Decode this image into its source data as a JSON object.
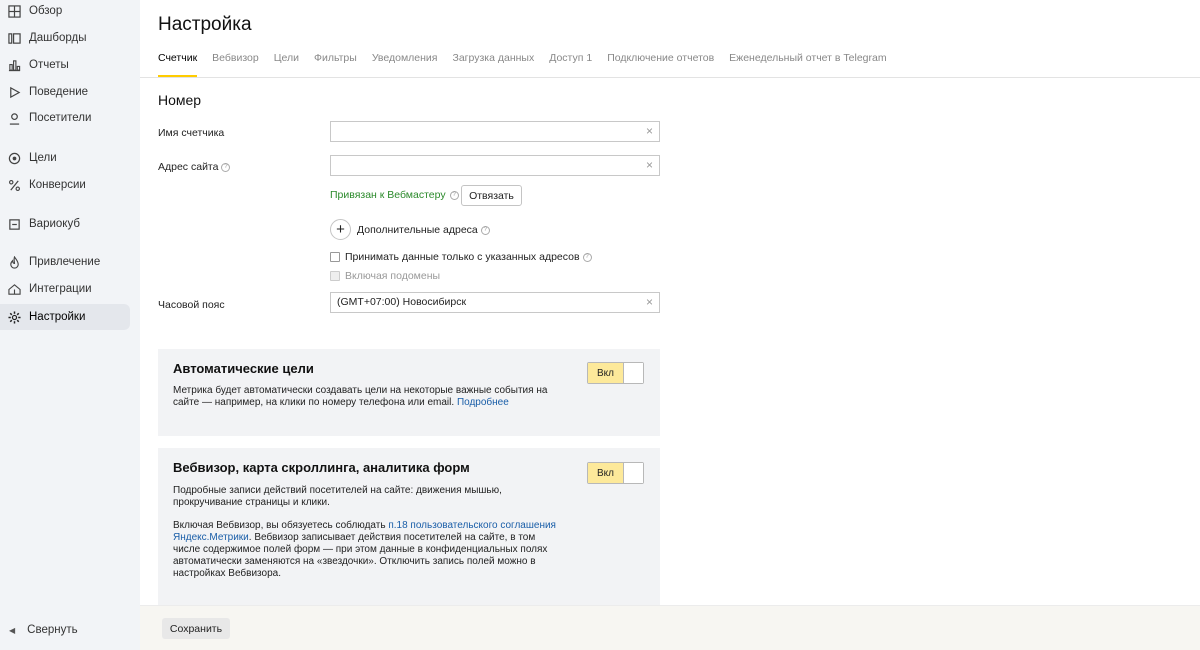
{
  "sidebar": {
    "items": [
      {
        "label": "Обзор",
        "icon": "grid-icon"
      },
      {
        "label": "Дашборды",
        "icon": "dashboards-icon"
      },
      {
        "label": "Отчеты",
        "icon": "bar-chart-icon"
      },
      {
        "label": "Поведение",
        "icon": "play-icon"
      },
      {
        "label": "Посетители",
        "icon": "user-icon"
      },
      {
        "label": "Цели",
        "icon": "target-icon"
      },
      {
        "label": "Конверсии",
        "icon": "percent-icon"
      },
      {
        "label": "Вариокуб",
        "icon": "cube-icon"
      },
      {
        "label": "Привлечение",
        "icon": "flame-icon"
      },
      {
        "label": "Интеграции",
        "icon": "integrations-icon"
      },
      {
        "label": "Настройки",
        "icon": "gear-icon",
        "active": true
      }
    ],
    "collapse_label": "Свернуть"
  },
  "header": {
    "title": "Настройка",
    "tabs": [
      {
        "label": "Счетчик",
        "active": true
      },
      {
        "label": "Вебвизор"
      },
      {
        "label": "Цели"
      },
      {
        "label": "Фильтры"
      },
      {
        "label": "Уведомления"
      },
      {
        "label": "Загрузка данных"
      },
      {
        "label": "Доступ 1"
      },
      {
        "label": "Подключение отчетов"
      },
      {
        "label": "Еженедельный отчет в Telegram"
      }
    ]
  },
  "form": {
    "section_title": "Номер",
    "counter_name_label": "Имя счетчика",
    "counter_name_value": "",
    "site_address_label": "Адрес сайта",
    "site_address_value": "",
    "webmaster_status": "Привязан к Вебмастеру",
    "unlink_label": "Отвязать",
    "additional_addresses_label": "Дополнительные адреса",
    "accept_only_label": "Принимать данные только с указанных адресов",
    "include_subdomains_label": "Включая подомены",
    "timezone_label": "Часовой пояс",
    "timezone_value": "(GMT+07:00) Новосибирск"
  },
  "auto_goals": {
    "title": "Автоматические цели",
    "text": "Метрика будет автоматически создавать цели на некоторые важные события на сайте — например, на клики по номеру телефона или email.",
    "link": "Подробнее",
    "toggle_label": "Вкл"
  },
  "webvisor": {
    "title": "Вебвизор, карта скроллинга, аналитика форм",
    "text1": "Подробные записи действий посетителей на сайте: движения мышью, прокручивание страницы и клики.",
    "text2_prefix": "Включая Вебвизор, вы обязуетесь соблюдать ",
    "text2_link": "п.18 пользовательского соглашения Яндекс.Метрики",
    "text2_suffix": ". Вебвизор записывает действия посетителей на сайте, в том числе содержимое полей форм — при этом данные в конфиденциальных полях автоматически заменяются на «звездочки». Отключить запись полей можно в настройках Вебвизора.",
    "toggle_label": "Вкл"
  },
  "footer": {
    "save_label": "Сохранить"
  },
  "colors": {
    "accent": "#ffcc00",
    "toggle_on": "#fde99a",
    "link": "#1a5ea8",
    "success": "#2b8a2b"
  }
}
